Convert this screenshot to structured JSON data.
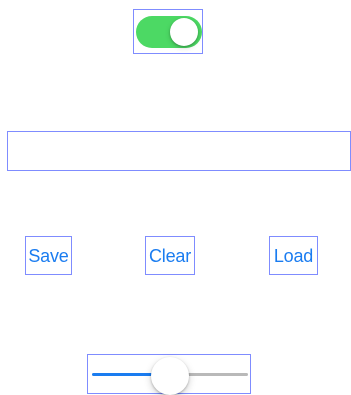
{
  "toggle": {
    "is_on": true,
    "on_color": "#4CD964"
  },
  "text_field": {
    "value": "",
    "placeholder": ""
  },
  "buttons": {
    "save_label": "Save",
    "clear_label": "Clear",
    "load_label": "Load",
    "text_color": "#1A7CF0"
  },
  "slider": {
    "value_fraction": 0.5,
    "min_track_color": "#1A7CF0",
    "max_track_color": "#B9B9B9"
  },
  "inspector": {
    "outline_color": "#7F8CFF"
  }
}
